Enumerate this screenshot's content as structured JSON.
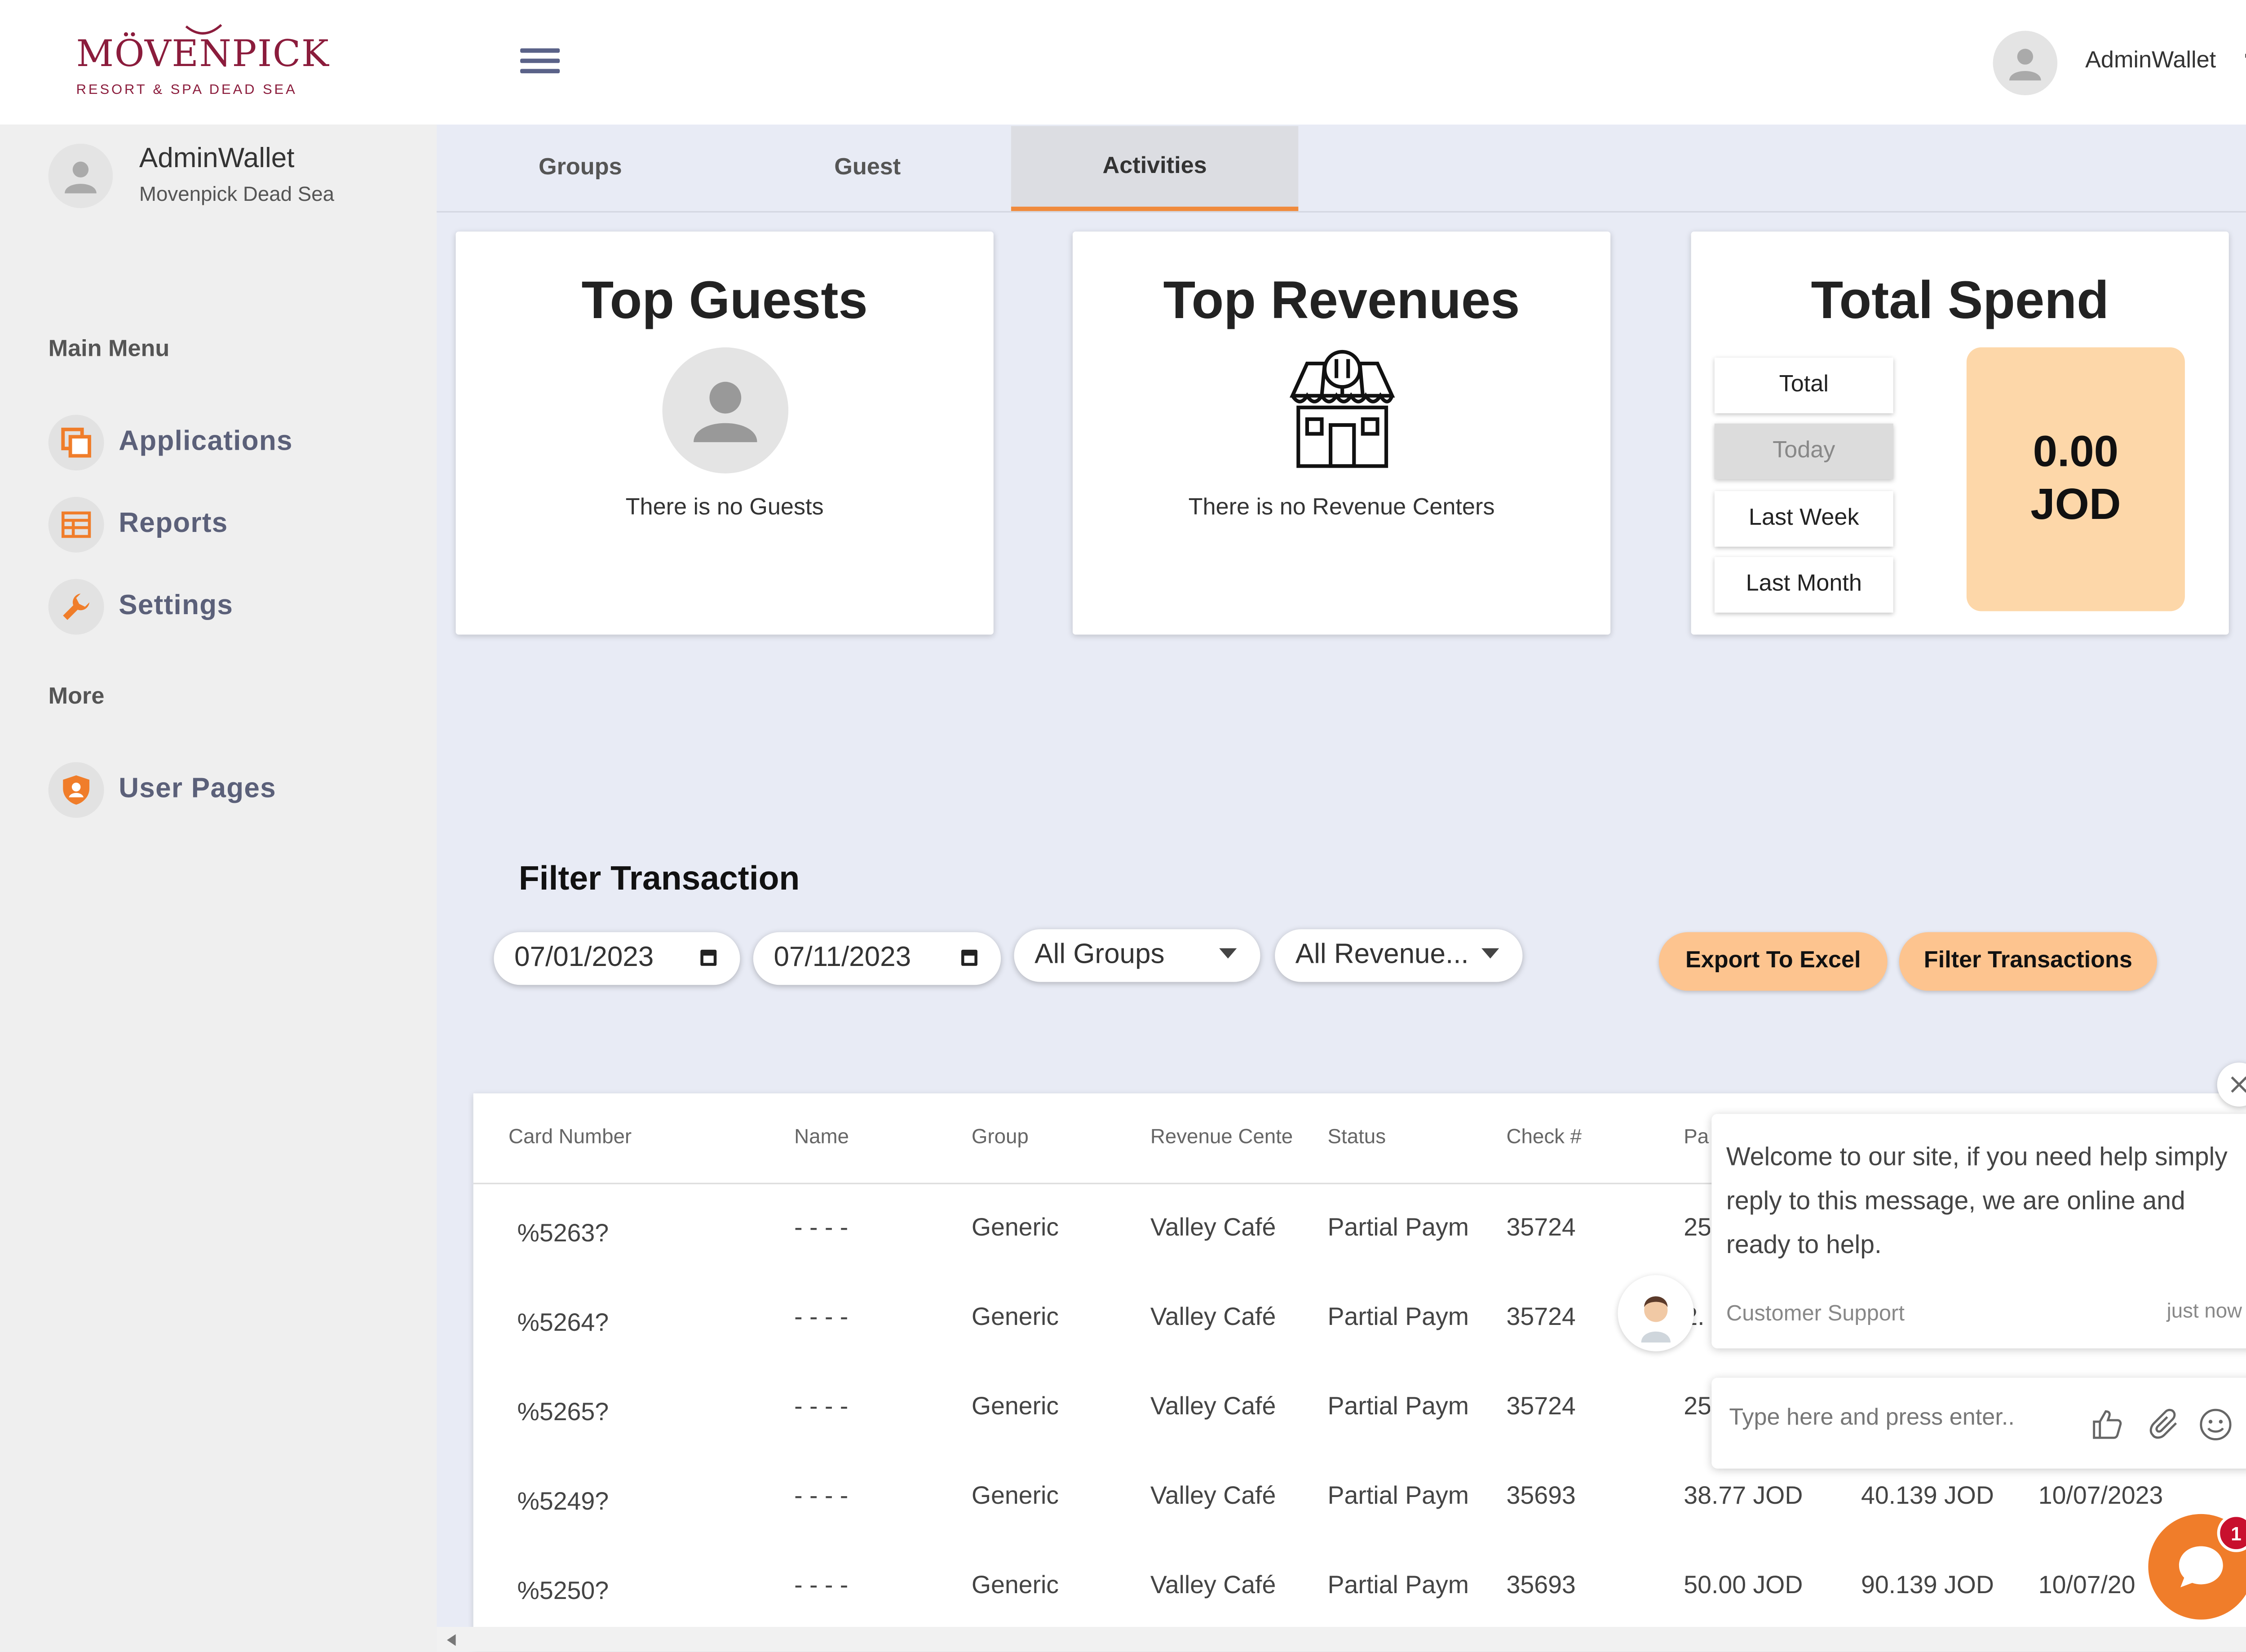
{
  "brand": {
    "name": "MÖVENPICK",
    "subtitle": "RESORT & SPA DEAD SEA",
    "color": "#8b1c3c"
  },
  "header": {
    "username": "AdminWallet",
    "more": "···"
  },
  "sidebar": {
    "user_name": "AdminWallet",
    "user_property": "Movenpick Dead Sea",
    "main_menu_label": "Main Menu",
    "items": [
      {
        "label": "Applications",
        "icon": "applications-icon"
      },
      {
        "label": "Reports",
        "icon": "reports-icon"
      },
      {
        "label": "Settings",
        "icon": "wrench-icon"
      }
    ],
    "more_label": "More",
    "more_items": [
      {
        "label": "User Pages",
        "icon": "shield-icon"
      }
    ]
  },
  "tabs": [
    {
      "label": "Groups",
      "active": false
    },
    {
      "label": "Guest",
      "active": false
    },
    {
      "label": "Activities",
      "active": true
    }
  ],
  "cards": {
    "top_guests": {
      "title": "Top Guests",
      "empty": "There is no Guests"
    },
    "top_revenues": {
      "title": "Top Revenues",
      "empty": "There is no Revenue Centers"
    },
    "total_spend": {
      "title": "Total Spend",
      "periods": [
        "Total",
        "Today",
        "Last Week",
        "Last Month"
      ],
      "selected": "Today",
      "amount": "0.00",
      "currency": "JOD"
    }
  },
  "filter": {
    "title": "Filter Transaction",
    "from_date": "07/01/2023",
    "to_date": "07/11/2023",
    "group": "All Groups",
    "revenue_center": "All Revenue...",
    "export_label": "Export To Excel",
    "filter_label": "Filter Transactions"
  },
  "table": {
    "columns": [
      "Card Number",
      "Name",
      "Group",
      "Revenue Cente",
      "Status",
      "Check #",
      "Pa",
      "",
      ""
    ],
    "rows": [
      [
        "%5263?",
        "- - - -",
        "Generic",
        "Valley Café",
        "Partial Paym",
        "35724",
        "25",
        "",
        ""
      ],
      [
        "%5264?",
        "- - - -",
        "Generic",
        "Valley Café",
        "Partial Paym",
        "35724",
        "2.",
        "",
        ""
      ],
      [
        "%5265?",
        "- - - -",
        "Generic",
        "Valley Café",
        "Partial Paym",
        "35724",
        "25",
        "",
        ""
      ],
      [
        "%5249?",
        "- - - -",
        "Generic",
        "Valley Café",
        "Partial Paym",
        "35693",
        "38.77 JOD",
        "40.139 JOD",
        "10/07/2023"
      ],
      [
        "%5250?",
        "- - - -",
        "Generic",
        "Valley Café",
        "Partial Paym",
        "35693",
        "50.00 JOD",
        "90.139 JOD",
        "10/07/20"
      ]
    ]
  },
  "chat": {
    "message": "Welcome to our site, if you need help simply reply to this message, we are online and ready to help.",
    "from": "Customer Support",
    "time": "just now",
    "placeholder": "Type here and press enter..",
    "badge": "1",
    "accent": "#f07d2a"
  }
}
